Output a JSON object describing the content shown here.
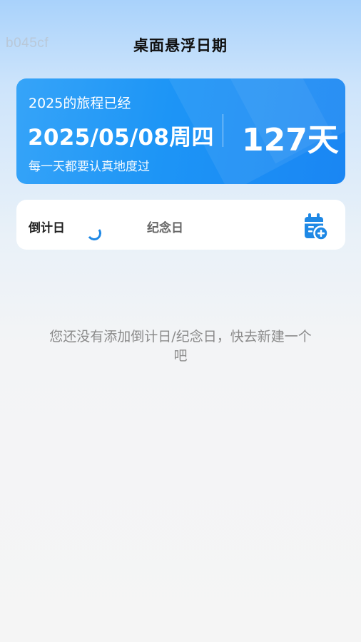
{
  "watermark": "b045cf",
  "header": {
    "title": "桌面悬浮日期"
  },
  "hero": {
    "caption": "2025的旅程已经",
    "date": "2025/05/08周四",
    "days": "127天",
    "motto": "每一天都要认真地度过"
  },
  "tabs": {
    "countdown": "倒计日",
    "anniversary": "纪念日",
    "add_icon": "calendar-add-icon"
  },
  "empty_state": {
    "message": "您还没有添加倒计日/纪念日，快去新建一个吧"
  },
  "colors": {
    "accent": "#1e88e5",
    "card_blue": "#1d95f6"
  }
}
